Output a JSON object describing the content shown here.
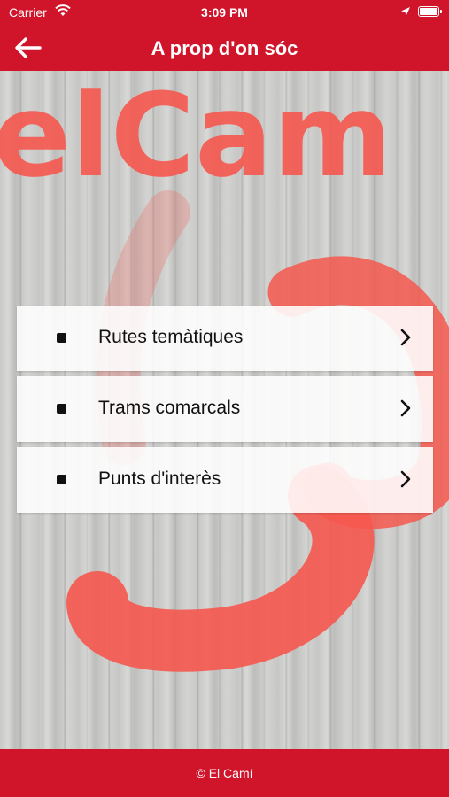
{
  "status_bar": {
    "carrier": "Carrier",
    "time": "3:09 PM"
  },
  "nav": {
    "title": "A prop d'on sóc",
    "back_icon": "arrow-left-icon"
  },
  "background": {
    "graffiti_text": "elCam"
  },
  "menu": {
    "items": [
      {
        "label": "Rutes temàtiques"
      },
      {
        "label": "Trams comarcals"
      },
      {
        "label": "Punts d'interès"
      }
    ]
  },
  "footer": {
    "text": "© El Camí"
  },
  "colors": {
    "brand_red": "#d0142a",
    "graffiti_red": "#f5584e"
  }
}
